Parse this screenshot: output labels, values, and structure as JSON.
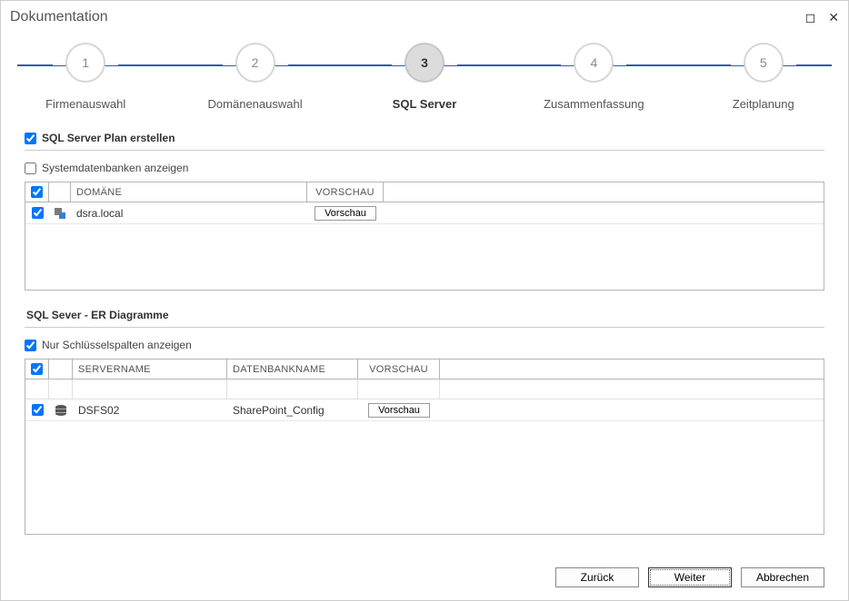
{
  "window": {
    "title": "Dokumentation"
  },
  "stepper": {
    "steps": [
      {
        "num": "1",
        "label": "Firmenauswahl"
      },
      {
        "num": "2",
        "label": "Domänenauswahl"
      },
      {
        "num": "3",
        "label": "SQL Server"
      },
      {
        "num": "4",
        "label": "Zusammenfassung"
      },
      {
        "num": "5",
        "label": "Zeitplanung"
      }
    ],
    "active_index": 2
  },
  "section1": {
    "checkbox_label": "SQL Server Plan erstellen",
    "show_system_db_label": "Systemdatenbanken anzeigen",
    "headers": {
      "domain": "DOMÄNE",
      "preview": "VORSCHAU"
    },
    "rows": [
      {
        "domain": "dsra.local",
        "preview_btn": "Vorschau"
      }
    ]
  },
  "section2": {
    "title": "SQL Sever - ER Diagramme",
    "key_cols_label": "Nur Schlüsselspalten anzeigen",
    "headers": {
      "server": "SERVERNAME",
      "db": "DATENBANKNAME",
      "preview": "VORSCHAU"
    },
    "rows": [
      {
        "server": "DSFS02",
        "db": "SharePoint_Config",
        "preview_btn": "Vorschau"
      }
    ]
  },
  "footer": {
    "back": "Zurück",
    "next": "Weiter",
    "cancel": "Abbrechen"
  }
}
